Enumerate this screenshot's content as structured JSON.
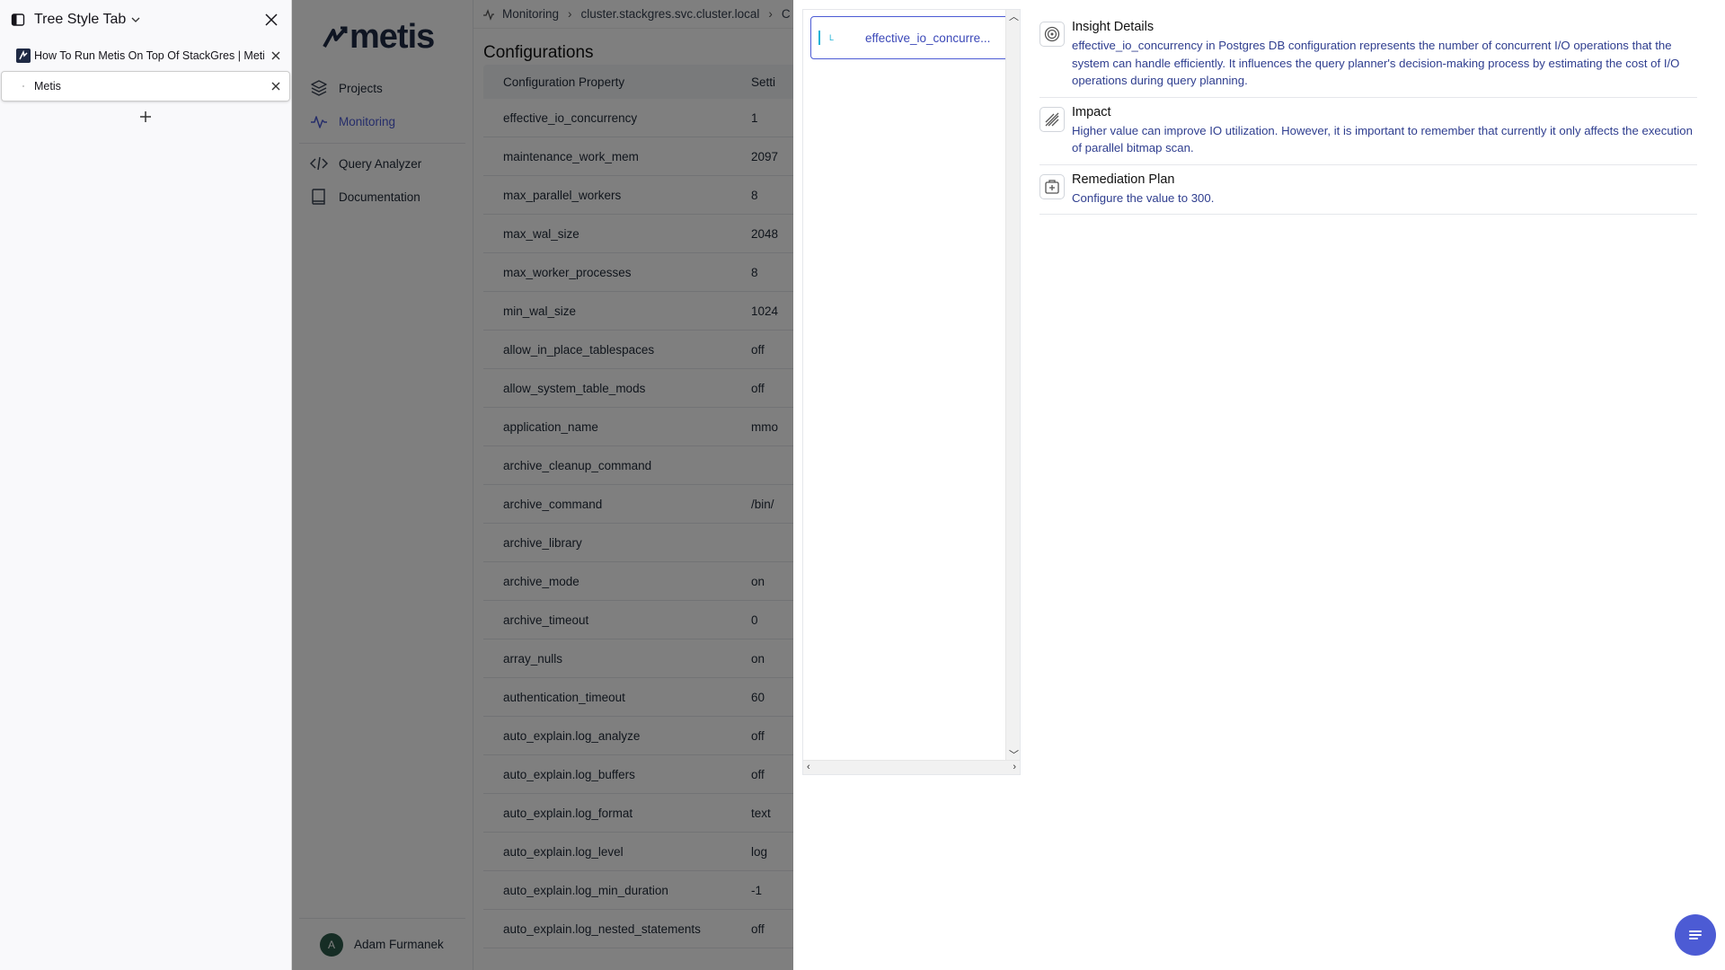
{
  "tst": {
    "title": "Tree Style Tab",
    "tabs": [
      {
        "label": "How To Run Metis On Top Of StackGres | Metis"
      },
      {
        "label": "Metis"
      }
    ]
  },
  "nav": {
    "logo": "metis",
    "items": [
      {
        "label": "Projects"
      },
      {
        "label": "Monitoring"
      },
      {
        "label": "Query Analyzer"
      },
      {
        "label": "Documentation"
      }
    ],
    "user": {
      "initial": "A",
      "name": "Adam Furmanek"
    }
  },
  "breadcrumb": {
    "items": [
      "Monitoring",
      "cluster.stackgres.svc.cluster.local",
      "C"
    ]
  },
  "page": {
    "title": "Configurations"
  },
  "table": {
    "headers": [
      "Configuration Property",
      "Setti"
    ],
    "rows": [
      [
        "effective_io_concurrency",
        "1"
      ],
      [
        "maintenance_work_mem",
        "2097"
      ],
      [
        "max_parallel_workers",
        "8"
      ],
      [
        "max_wal_size",
        "2048"
      ],
      [
        "max_worker_processes",
        "8"
      ],
      [
        "min_wal_size",
        "1024"
      ],
      [
        "allow_in_place_tablespaces",
        "off"
      ],
      [
        "allow_system_table_mods",
        "off"
      ],
      [
        "application_name",
        "mmo"
      ],
      [
        "archive_cleanup_command",
        ""
      ],
      [
        "archive_command",
        "/bin/"
      ],
      [
        "archive_library",
        ""
      ],
      [
        "archive_mode",
        "on"
      ],
      [
        "archive_timeout",
        "0"
      ],
      [
        "array_nulls",
        "on"
      ],
      [
        "authentication_timeout",
        "60"
      ],
      [
        "auto_explain.log_analyze",
        "off"
      ],
      [
        "auto_explain.log_buffers",
        "off"
      ],
      [
        "auto_explain.log_format",
        "text"
      ],
      [
        "auto_explain.log_level",
        "log"
      ],
      [
        "auto_explain.log_min_duration",
        "-1"
      ],
      [
        "auto_explain.log_nested_statements",
        "off"
      ]
    ]
  },
  "panel": {
    "list_item": {
      "level": "L",
      "name": "effective_io_concurre..."
    },
    "sections": [
      {
        "title": "Insight Details",
        "text": "effective_io_concurrency in Postgres DB configuration represents the number of concurrent I/O operations that the system can handle efficiently. It influences the query planner's decision-making process by estimating the cost of I/O operations during query planning."
      },
      {
        "title": "Impact",
        "text": "Higher value can improve IO utilization. However, it is important to remember that currently it only affects the execution of parallel bitmap scan."
      },
      {
        "title": "Remediation Plan",
        "text": "Configure the value to 300."
      }
    ]
  },
  "colors": {
    "accent": "#4c5bd4",
    "level": "#22b3d6",
    "overlay": "rgba(0,0,0,0.5)"
  }
}
